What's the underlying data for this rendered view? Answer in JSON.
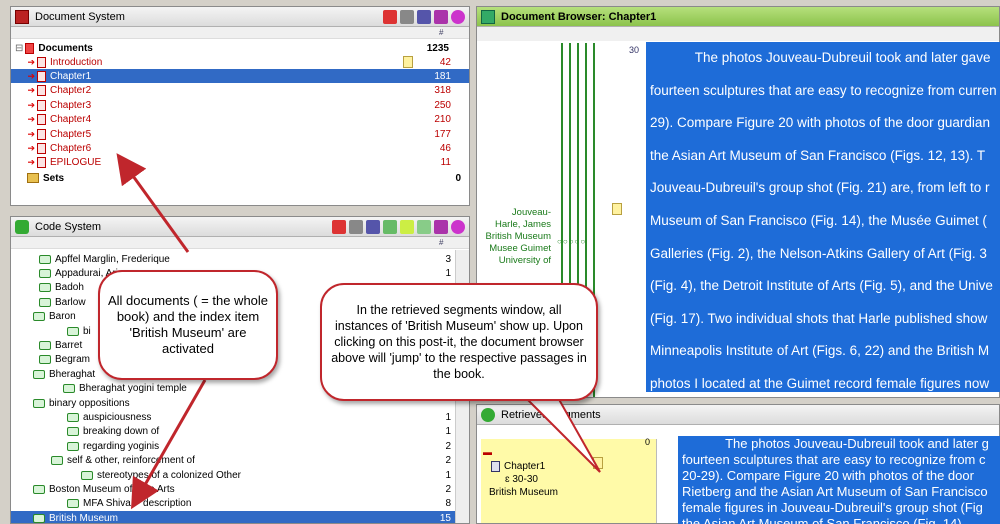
{
  "doc_system": {
    "title": "Document System",
    "root": {
      "label": "Documents",
      "count": "1235"
    },
    "docs": [
      {
        "label": "Introduction",
        "count": "42",
        "memo": true
      },
      {
        "label": "Chapter1",
        "count": "181",
        "selected": true
      },
      {
        "label": "Chapter2",
        "count": "318"
      },
      {
        "label": "Chapter3",
        "count": "250"
      },
      {
        "label": "Chapter4",
        "count": "210"
      },
      {
        "label": "Chapter5",
        "count": "177"
      },
      {
        "label": "Chapter6",
        "count": "46"
      },
      {
        "label": "EPILOGUE",
        "count": "11"
      }
    ],
    "sets": {
      "label": "Sets",
      "count": "0"
    }
  },
  "code_system": {
    "title": "Code System",
    "codes": [
      {
        "label": "Apffel Marglin, Frederique",
        "count": "3"
      },
      {
        "label": "Appadurai, Arjun",
        "count": "1"
      },
      {
        "label": "Badoh",
        "count": ""
      },
      {
        "label": "Barlow",
        "count": ""
      },
      {
        "label": "Baron",
        "count": ""
      },
      {
        "label": "bi",
        "count": ""
      },
      {
        "label": "Barret",
        "count": ""
      },
      {
        "label": "Begram",
        "count": ""
      },
      {
        "label": "Bheraghat",
        "count": ""
      },
      {
        "label": "Bheraghat yogini temple",
        "count": ""
      },
      {
        "label": "binary oppositions",
        "count": ""
      },
      {
        "label": "auspiciousness",
        "count": "1"
      },
      {
        "label": "breaking down of",
        "count": "1"
      },
      {
        "label": "regarding yoginis",
        "count": "2"
      },
      {
        "label": "self & other, reinforcement of",
        "count": "2"
      },
      {
        "label": "stereotypes of a colonized Other",
        "count": "1"
      },
      {
        "label": "Boston Museum of Fine Arts",
        "count": "2"
      },
      {
        "label": "MFA Shiva -- description",
        "count": "8"
      },
      {
        "label": "British Museum",
        "count": "15"
      }
    ]
  },
  "browser": {
    "title": "Document Browser: Chapter1",
    "para_number": "30",
    "code_labels": [
      "Jouveau-",
      "Harle, James",
      "British Museum",
      "Musee Guimet",
      "University of"
    ],
    "lines": [
      "            The photos Jouveau-Dubreuil took and later gave",
      "fourteen sculptures that are easy to recognize from curren",
      "29). Compare Figure 20 with photos of the door guardian",
      "the Asian Art Museum of San Francisco (Figs. 12, 13). T",
      "Jouveau-Dubreuil's group shot (Fig. 21) are, from left to r",
      "Museum of San Francisco (Fig. 14), the Musée Guimet (",
      "Galleries (Fig. 2), the Nelson-Atkins Gallery of Art (Fig. 3",
      "(Fig. 4), the Detroit Institute of Arts (Fig. 5), and the Unive",
      "(Fig. 17). Two individual shots that Harle published show",
      "Minneapolis Institute of Art (Figs. 6, 22) and the British M",
      "photos I located at the Guimet record female figures now"
    ]
  },
  "segments": {
    "title": "Retrieved Segments",
    "count": "0",
    "doc": "Chapter1",
    "range": "ɛ 30-30",
    "code": "British Museum",
    "lines": [
      "            The photos Jouveau-Dubreuil took and later g",
      "fourteen sculptures that are easy to recognize from c",
      "20-29). Compare Figure 20 with photos of the door",
      "Rietberg and the Asian Art Museum of San Francisco",
      "female figures in Jouveau-Dubreuil's group shot (Fig",
      "the Asian Art Museum of San Francisco (Fig. 14)"
    ]
  },
  "callouts": {
    "left": "All documents ( = the whole book) and the index item 'British Museum' are activated",
    "right": "In the retrieved segments window, all instances of 'British Museum' show up. Upon clicking on this post-it, the document browser above will 'jump' to the respective passages in the book."
  },
  "colors": {
    "selection": "#316ac5",
    "accent_red": "#c0262c",
    "browser_blue": "#1e6cd8",
    "memo_yellow": "#fff2a0"
  }
}
